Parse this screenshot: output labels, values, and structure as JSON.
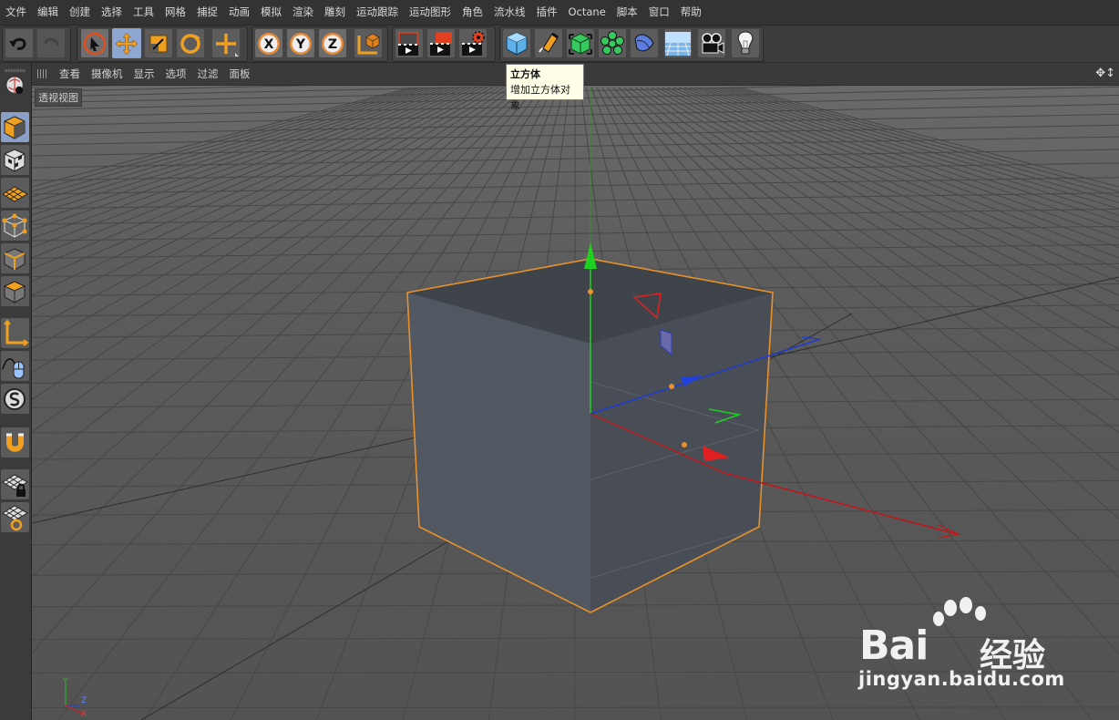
{
  "menu": [
    "文件",
    "编辑",
    "创建",
    "选择",
    "工具",
    "网格",
    "捕捉",
    "动画",
    "模拟",
    "渲染",
    "雕刻",
    "运动跟踪",
    "运动图形",
    "角色",
    "流水线",
    "插件",
    "Octane",
    "脚本",
    "窗口",
    "帮助"
  ],
  "view_menu": [
    "查看",
    "摄像机",
    "显示",
    "选项",
    "过滤",
    "面板"
  ],
  "view_label": "透视视图",
  "tooltip": {
    "title": "立方体",
    "description": "增加立方体对象"
  },
  "axis_labels": {
    "y": "Y",
    "z": "Z",
    "x": "X"
  },
  "toolbar_icons": [
    "undo-icon",
    "redo-icon",
    "live-select-icon",
    "move-icon",
    "scale-icon",
    "rotate-icon",
    "recent-tool-icon",
    "x-axis-lock-icon",
    "y-axis-lock-icon",
    "z-axis-lock-icon",
    "coordinate-system-icon",
    "render-view-icon",
    "render-picture-viewer-icon",
    "render-settings-icon",
    "cube-icon",
    "pen-icon",
    "subdivision-icon",
    "cloner-icon",
    "deformer-icon",
    "floor-icon",
    "camera-icon",
    "light-icon"
  ],
  "sidebar_icons": [
    "viewport-solo-icon",
    "model-mode-icon",
    "texture-mode-icon",
    "workplane-icon",
    "points-mode-icon",
    "edges-mode-icon",
    "polygons-mode-icon",
    "axis-mode-icon",
    "tweak-mode-icon",
    "snap-icon",
    "magnet-icon",
    "workplane-lock-icon",
    "workplane-align-icon"
  ],
  "watermark": {
    "brand": "Bai",
    "brand_cn": "经验",
    "url": "jingyan.baidu.com"
  },
  "colors": {
    "accent": "#f0a020",
    "selection": "#e8912a",
    "x_axis": "#e02020",
    "y_axis": "#20d020",
    "z_axis": "#2040e0"
  }
}
